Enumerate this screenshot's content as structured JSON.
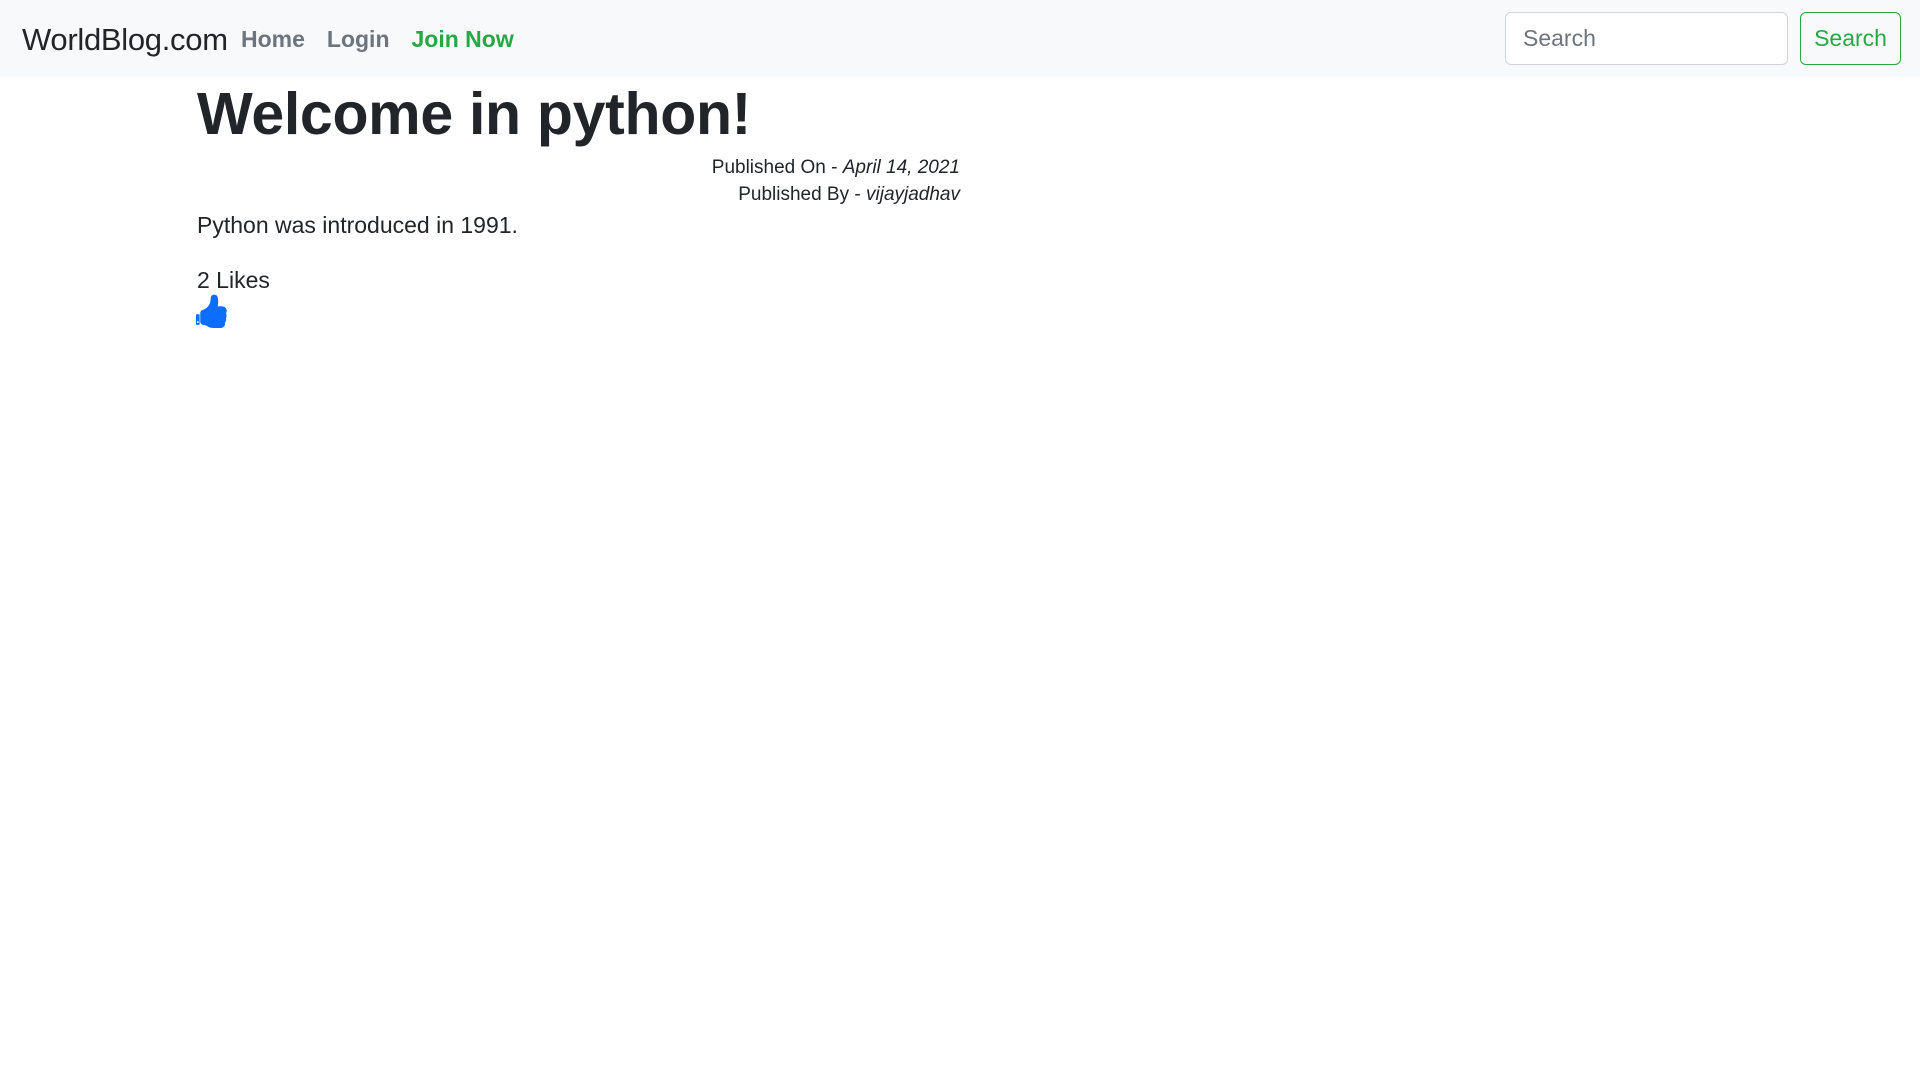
{
  "navbar": {
    "brand": "WorldBlog.com",
    "links": [
      {
        "label": "Home"
      },
      {
        "label": "Login"
      },
      {
        "label": "Join Now"
      }
    ],
    "search": {
      "placeholder": "Search",
      "value": "",
      "button_label": "Search"
    }
  },
  "post": {
    "title": "Welcome in python!",
    "published_on_label": "Published On - ",
    "published_on": "April 14, 2021",
    "published_by_label": "Published By - ",
    "published_by": "vijayjadhav",
    "body": "Python was introduced in 1991.",
    "likes": "2 Likes",
    "like_icon": "thumbs-up-icon"
  },
  "colors": {
    "navbar_bg": "#f8f9fa",
    "accent_green": "#28a745",
    "nav_muted": "#6c757d",
    "like_blue": "#0d6efd"
  }
}
